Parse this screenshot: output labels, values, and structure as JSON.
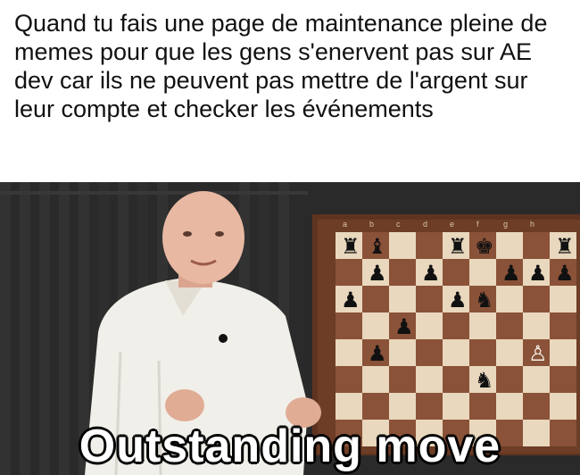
{
  "meme": {
    "caption": "Quand tu fais une page de maintenance pleine de memes pour que les gens s'enervent pas sur AE dev car ils ne peuvent pas mettre de l'argent sur leur compte et checker les événements",
    "bottom_text": "Outstanding move"
  },
  "colors": {
    "board_light": "#e9d8bd",
    "board_dark": "#8a5238",
    "frame": "#5e3420",
    "shirt": "#f1efe9",
    "skin": "#e8b8a2",
    "background": "#262626"
  },
  "board": {
    "files": [
      "a",
      "b",
      "c",
      "d",
      "e",
      "f",
      "g",
      "h"
    ]
  }
}
